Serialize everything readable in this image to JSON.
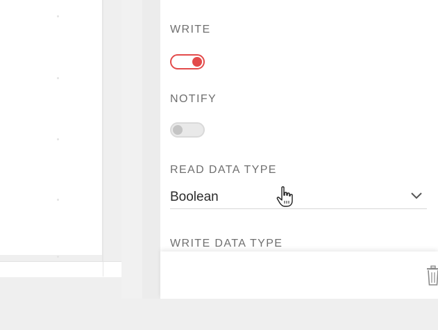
{
  "properties": {
    "write": {
      "label": "WRITE",
      "enabled": true
    },
    "notify": {
      "label": "NOTIFY",
      "enabled": false
    },
    "read_data_type": {
      "label": "READ DATA TYPE",
      "value": "Boolean"
    },
    "write_data_type": {
      "label": "WRITE DATA TYPE"
    }
  },
  "icons": {
    "dropdown": "chevron-down-icon",
    "delete": "trash-icon",
    "cursor": "hand-pointer-icon"
  },
  "colors": {
    "accent": "#e34a4a",
    "toggle_off": "#c4c4c4",
    "label": "#6f6f6f",
    "value": "#2b2b2b"
  }
}
